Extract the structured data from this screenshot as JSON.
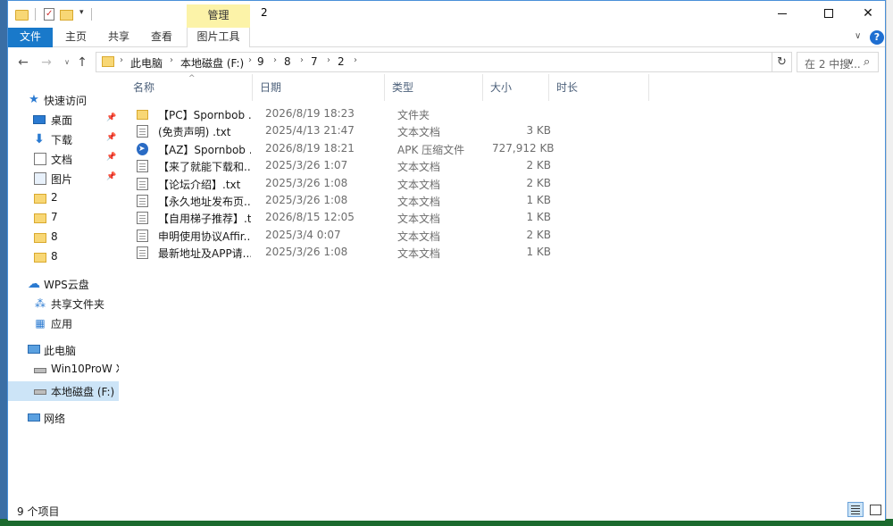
{
  "title_bar": {
    "context_tab": "管理",
    "window_title": "2",
    "quick_access_dropdown": "▾"
  },
  "ribbon": {
    "tabs": {
      "file": "文件",
      "home": "主页",
      "share": "共享",
      "view": "查看",
      "picture_tools": "图片工具"
    },
    "help": "?"
  },
  "address": {
    "crumbs": [
      "此电脑",
      "本地磁盘 (F:)",
      "9",
      "8",
      "7",
      "2"
    ],
    "separator": "›",
    "search_placeholder": "在 2 中搜..."
  },
  "nav_pane": {
    "quick_access": "快速访问",
    "pinned": [
      {
        "label": "桌面",
        "icon": "desktop-icon"
      },
      {
        "label": "下载",
        "icon": "download-icon"
      },
      {
        "label": "文档",
        "icon": "document-icon"
      },
      {
        "label": "图片",
        "icon": "picture-icon"
      }
    ],
    "recent_folders": [
      "2",
      "7",
      "8",
      "8"
    ],
    "wps_cloud": "WPS云盘",
    "shared_folder": "共享文件夹",
    "apps": "应用",
    "this_pc": "此电脑",
    "drives": [
      "Win10ProW X",
      "本地磁盘 (F:)"
    ],
    "network": "网络"
  },
  "file_list": {
    "columns": {
      "name": "名称",
      "date": "日期",
      "type": "类型",
      "size": "大小",
      "duration": "时长"
    },
    "rows": [
      {
        "icon": "folder-icon",
        "name": "【PC】Spornbob ...",
        "date": "2026/8/19 18:23",
        "type": "文件夹",
        "size": ""
      },
      {
        "icon": "text-file-icon",
        "name": "(免责声明) .txt",
        "date": "2025/4/13 21:47",
        "type": "文本文档",
        "size": "3 KB"
      },
      {
        "icon": "apk-file-icon",
        "name": "【AZ】Spornbob ...",
        "date": "2026/8/19 18:21",
        "type": "APK 压缩文件",
        "size": "727,912 KB"
      },
      {
        "icon": "text-file-icon",
        "name": "【来了就能下载和...",
        "date": "2025/3/26 1:07",
        "type": "文本文档",
        "size": "2 KB"
      },
      {
        "icon": "text-file-icon",
        "name": "【论坛介绍】.txt",
        "date": "2025/3/26 1:08",
        "type": "文本文档",
        "size": "2 KB"
      },
      {
        "icon": "text-file-icon",
        "name": "【永久地址发布页...",
        "date": "2025/3/26 1:08",
        "type": "文本文档",
        "size": "1 KB"
      },
      {
        "icon": "text-file-icon",
        "name": "【自用梯子推荐】.txt",
        "date": "2026/8/15 12:05",
        "type": "文本文档",
        "size": "1 KB"
      },
      {
        "icon": "text-file-icon",
        "name": "申明使用协议Affir...",
        "date": "2025/3/4 0:07",
        "type": "文本文档",
        "size": "2 KB"
      },
      {
        "icon": "text-file-icon",
        "name": "最新地址及APP请...",
        "date": "2025/3/26 1:08",
        "type": "文本文档",
        "size": "1 KB"
      }
    ]
  },
  "status_bar": {
    "item_count": "9 个项目"
  }
}
